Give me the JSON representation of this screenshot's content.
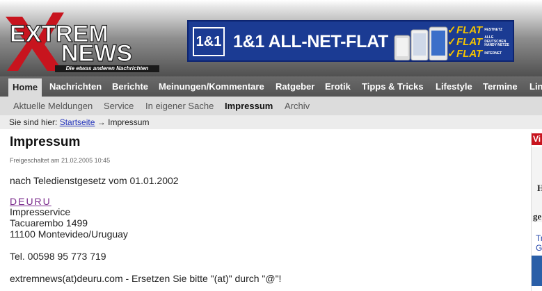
{
  "header": {
    "logo": {
      "line1": "EXTREM",
      "line2": "NEWS",
      "tagline": "Die etwas anderen Nachrichten"
    },
    "banner": {
      "logo_text": "1&1",
      "title": "1&1 ALL-NET-FLAT",
      "flats": [
        {
          "word": "FLAT",
          "sub": "FESTNETZ"
        },
        {
          "word": "FLAT",
          "sub": "ALLE DEUTSCHEN HANDY-NETZE"
        },
        {
          "word": "FLAT",
          "sub": "INTERNET"
        }
      ]
    }
  },
  "topnav": {
    "items": [
      "Home",
      "Nachrichten",
      "Berichte",
      "Meinungen/Kommentare",
      "Ratgeber",
      "Erotik",
      "Tipps & Tricks",
      "Lifestyle",
      "Termine",
      "Lin"
    ]
  },
  "subnav": {
    "items": [
      "Aktuelle Meldungen",
      "Service",
      "In eigener Sache",
      "Impressum",
      "Archiv"
    ]
  },
  "breadcrumb": {
    "label": "Sie sind hier:",
    "home": "Startseite",
    "arrow": "→",
    "current": "Impressum"
  },
  "page": {
    "title": "Impressum",
    "published": "Freigeschaltet am 21.02.2005 10:45",
    "law": "nach Teledienstgesetz vom 01.01.2002",
    "company_link": "DEURU",
    "address": [
      "Impresservice",
      "Tacuarembo 1499",
      "11100 Montevideo/Uruguay"
    ],
    "phone": "Tel. 00598 95 773 719",
    "email_note": "extremnews(at)deuru.com - Ersetzen Sie bitte \"(at)\" durch \"@\"!"
  },
  "sidebar": {
    "head": "Vi",
    "letters": [
      "H",
      "ge"
    ],
    "links": [
      "Tr",
      "G"
    ]
  },
  "colors": {
    "brand_red": "#c8141e",
    "banner_blue": "#1b3b93",
    "flat_yellow": "#f5c400",
    "link_blue": "#2233bb",
    "visited_purple": "#7a2a8c"
  }
}
